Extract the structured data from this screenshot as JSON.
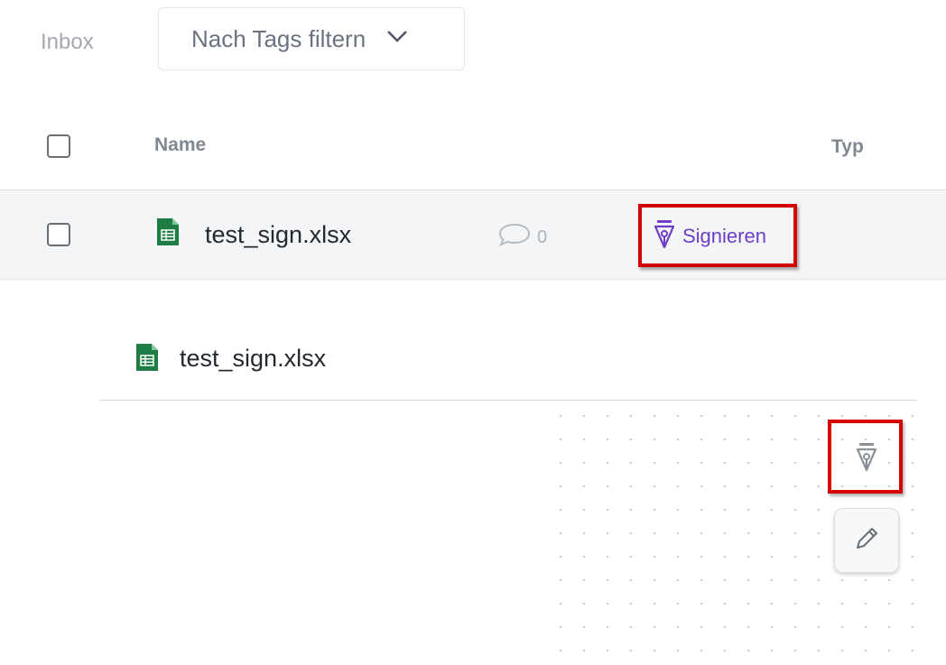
{
  "filter_bar": {
    "inbox_label": "Inbox",
    "tag_filter_label": "Nach Tags filtern"
  },
  "table": {
    "columns": {
      "name": "Name",
      "type": "Typ"
    },
    "rows": [
      {
        "filename": "test_sign.xlsx",
        "file_icon": "spreadsheet-icon",
        "comment_count": "0",
        "action_label": "Signieren",
        "action_icon": "fountain-pen-icon",
        "highlighted": true
      }
    ]
  },
  "detail": {
    "filename": "test_sign.xlsx",
    "tools": [
      {
        "icon": "fountain-pen-icon",
        "highlighted": true
      },
      {
        "icon": "pencil-icon",
        "highlighted": false
      }
    ]
  },
  "colors": {
    "accent": "#6d3fc8",
    "highlight": "#d40000",
    "spreadsheet_green": "#1e7d45"
  }
}
